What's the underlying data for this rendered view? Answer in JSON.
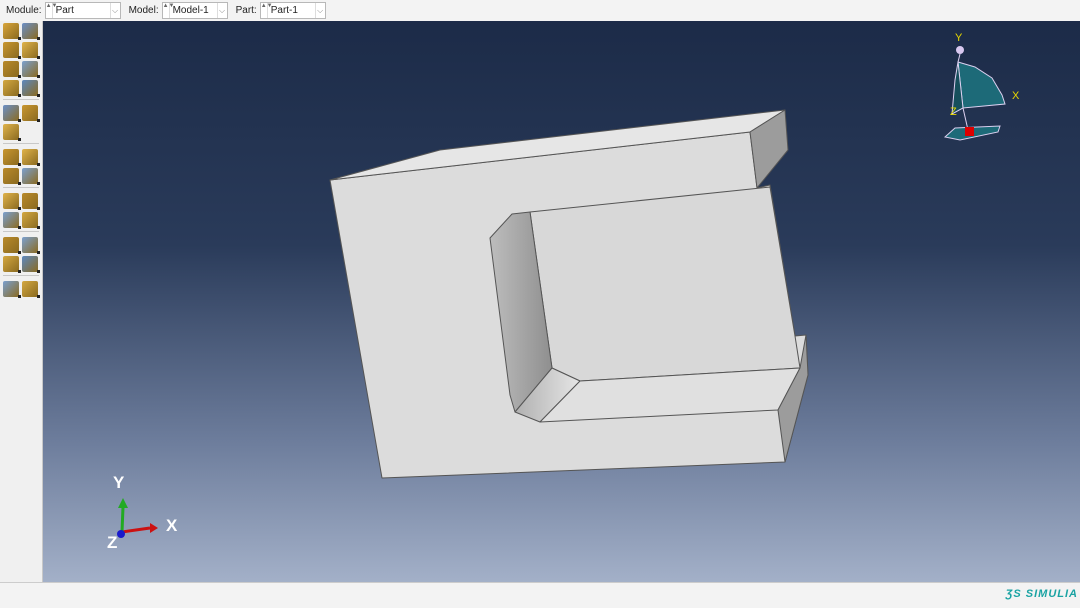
{
  "context_bar": {
    "module": {
      "label": "Module:",
      "value": "Part"
    },
    "model": {
      "label": "Model:",
      "value": "Model-1"
    },
    "part": {
      "label": "Part:",
      "value": "Part-1"
    }
  },
  "toolbox": {
    "groups": [
      [
        "create-part",
        "part-manager",
        "create-solid-extrude",
        "create-shell",
        "create-wire",
        "create-cut",
        "create-round",
        "repair-tool"
      ],
      [
        "partition-cell",
        "partition-face",
        "virtual-topology"
      ],
      [
        "datum-point",
        "partition-edge",
        "create-set",
        "remove-geometry"
      ],
      [
        "datum-xyz",
        "datum-axis",
        "datum-csys",
        "datum-plane"
      ],
      [
        "query",
        "mesh-seed",
        "attribute-edit",
        "geometry-repair"
      ],
      [
        "assembly-instance",
        "translate-instance"
      ]
    ]
  },
  "viewport": {
    "triad": {
      "x": "X",
      "y": "Y",
      "z": "Z"
    },
    "view_cube": {
      "x": "X",
      "y": "Y",
      "z": "Z"
    }
  },
  "brand": "SIMULIA",
  "colors": {
    "viewport_top": "#1c2b48",
    "viewport_bottom": "#a3b0c8",
    "part": "#dcdcdc",
    "x_axis": "#cc1111",
    "y_axis": "#22aa22",
    "z_axis": "#1a1acc",
    "brand": "#1aa3a3"
  }
}
